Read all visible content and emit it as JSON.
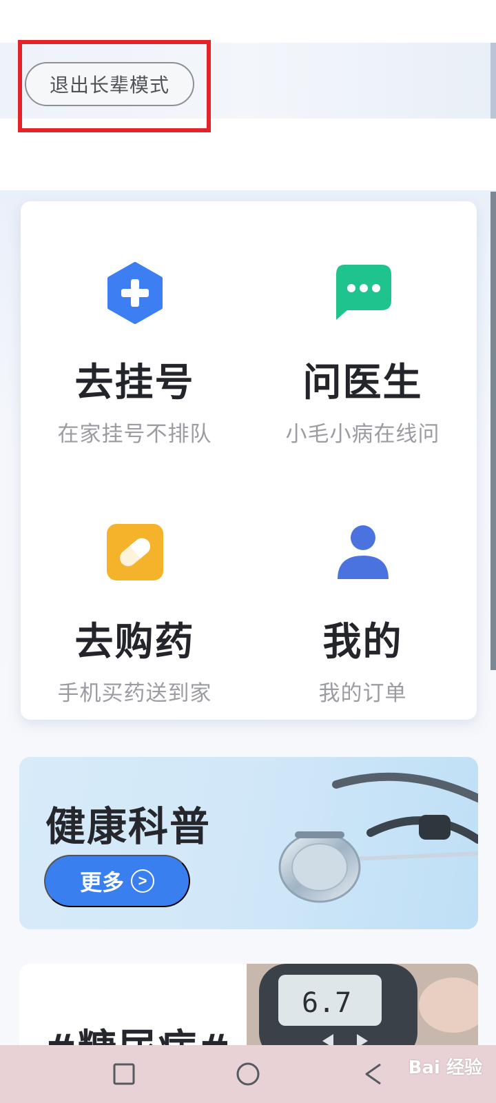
{
  "header": {
    "exit_elder_mode": "退出长辈模式"
  },
  "menu": {
    "items": [
      {
        "title": "去挂号",
        "subtitle": "在家挂号不排队",
        "icon": "hexagon-plus-icon",
        "color": "#3d7ef2"
      },
      {
        "title": "问医生",
        "subtitle": "小毛小病在线问",
        "icon": "chat-bubble-icon",
        "color": "#1fc38e"
      },
      {
        "title": "去购药",
        "subtitle": "手机买药送到家",
        "icon": "pill-icon",
        "color": "#f4b32a"
      },
      {
        "title": "我的",
        "subtitle": "我的订单",
        "icon": "user-icon",
        "color": "#4a73e0"
      }
    ]
  },
  "health_banner": {
    "title": "健康科普",
    "more_label": "更多"
  },
  "topic_card": {
    "title": "#糖尿病#"
  },
  "navbar": {
    "buttons": [
      "recent-apps",
      "home",
      "back"
    ]
  },
  "watermark": {
    "text": "Bai 经验"
  }
}
